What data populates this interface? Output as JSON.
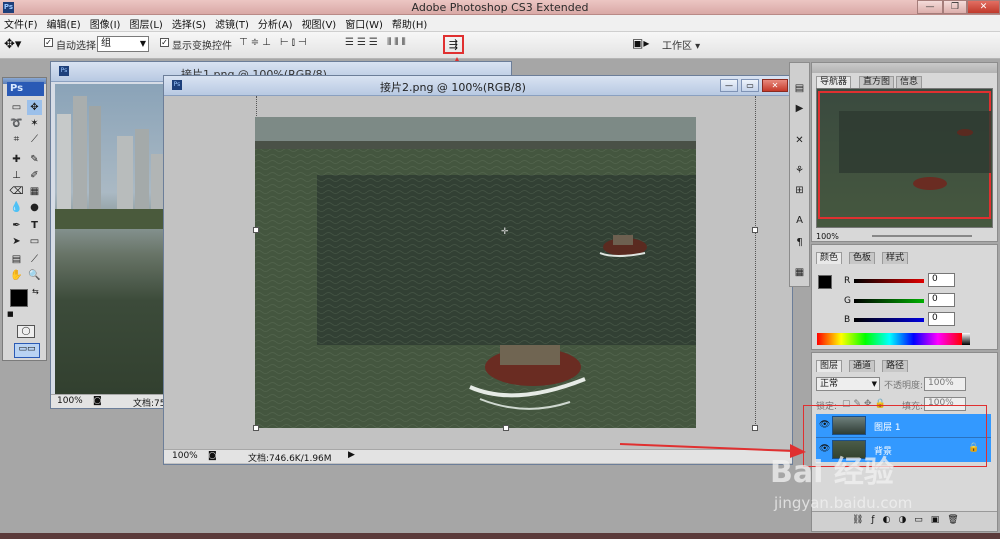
{
  "app": {
    "title": "Adobe Photoshop CS3 Extended",
    "logo": "Ps",
    "window_controls": [
      "minimize-icon",
      "restore-icon",
      "close-icon"
    ]
  },
  "menu": [
    "文件(F)",
    "编辑(E)",
    "图像(I)",
    "图层(L)",
    "选择(S)",
    "滤镜(T)",
    "分析(A)",
    "视图(V)",
    "窗口(W)",
    "帮助(H)"
  ],
  "options": {
    "auto_select_label": "自动选择:",
    "auto_select_value": "组",
    "show_transform_label": "显示变换控件",
    "workspace_label": "工作区",
    "icon_names": [
      "move-tool-icon",
      "align-top-icon",
      "align-vcenter-icon",
      "align-bottom-icon",
      "align-left-icon",
      "align-hcenter-icon",
      "align-right-icon",
      "distribute-top-icon",
      "distribute-vcenter-icon",
      "distribute-bottom-icon",
      "distribute-left-icon",
      "distribute-hcenter-icon",
      "distribute-right-icon",
      "auto-align-layers-icon"
    ]
  },
  "documents": [
    {
      "title": "接片1.png @ 100%(RGB/8)",
      "zoom": "100%",
      "status": "文档:75"
    },
    {
      "title": "接片2.png @ 100%(RGB/8)",
      "zoom": "100%",
      "status": "文档:746.6K/1.96M"
    }
  ],
  "navigator": {
    "tabs": [
      "导航器",
      "直方图",
      "信息"
    ],
    "zoom": "100%"
  },
  "color": {
    "tabs": [
      "颜色",
      "色板",
      "样式"
    ],
    "channels": [
      {
        "label": "R",
        "value": "0",
        "color": "#e00000"
      },
      {
        "label": "G",
        "value": "0",
        "color": "#00b000"
      },
      {
        "label": "B",
        "value": "0",
        "color": "#0000e0"
      }
    ]
  },
  "layers": {
    "tabs": [
      "图层",
      "通道",
      "路径"
    ],
    "blend_mode": "正常",
    "opacity_label": "不透明度:",
    "opacity_value": "100%",
    "lock_label": "锁定:",
    "fill_label": "填充:",
    "fill_value": "100%",
    "items": [
      {
        "name": "图层 1",
        "selected": true
      },
      {
        "name": "背景",
        "selected": true,
        "locked": true
      }
    ]
  },
  "colors": {
    "accent_red": "#e03030",
    "selection_blue": "#3399ff"
  },
  "watermark": {
    "brand": "Bai 经验",
    "url": "jingyan.baidu.com"
  }
}
